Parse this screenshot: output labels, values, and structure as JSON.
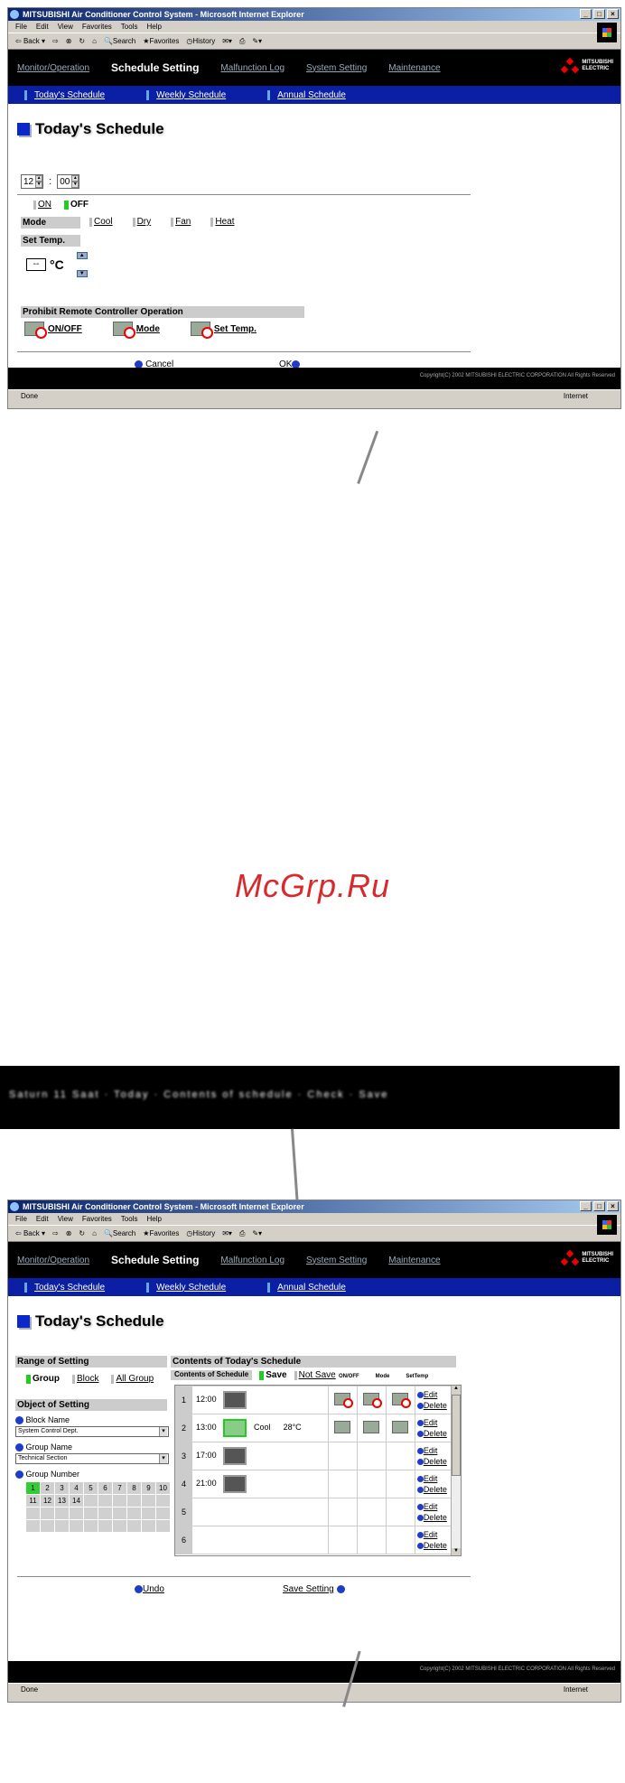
{
  "win1": {
    "title": "MITSUBISHI Air Conditioner Control System - Microsoft Internet Explorer",
    "menu": [
      "File",
      "Edit",
      "View",
      "Favorites",
      "Tools",
      "Help"
    ],
    "toolbar": [
      "Back",
      "Search",
      "Favorites",
      "History"
    ],
    "nav": [
      "Monitor/Operation",
      "Schedule Setting",
      "Malfunction Log",
      "System Setting",
      "Maintenance"
    ],
    "brand": [
      "MITSUBISHI",
      "ELECTRIC"
    ],
    "subnav": [
      "Today's Schedule",
      "Weekly Schedule",
      "Annual Schedule"
    ],
    "page_title": "Today's Schedule",
    "hour": "12",
    "minute": "00",
    "on": "ON",
    "off": "OFF",
    "mode_label": "Mode",
    "modes": [
      "Cool",
      "Dry",
      "Fan",
      "Heat"
    ],
    "settemp_label": "Set Temp.",
    "temp_value": "--",
    "temp_unit": "°C",
    "prohibit_label": "Prohibit Remote Controller Operation",
    "prohibit": [
      "ON/OFF",
      "Mode",
      "Set Temp."
    ],
    "cancel": "Cancel",
    "ok": "OK",
    "copyright": "Copyright(C) 2002 MITSUBISHI ELECTRIC CORPORATION All Rights Reserved",
    "status": "Done",
    "zone": "Internet"
  },
  "watermark": "McGrp.Ru",
  "blurred_caption": "Saturn 11 Saat · Today · Contents of schedule · Check · Save",
  "win2": {
    "range_label": "Range of Setting",
    "ranges": [
      "Group",
      "Block",
      "All Group"
    ],
    "object_label": "Object of Setting",
    "block_name_label": "Block Name",
    "block_name_value": "System Control Dept.",
    "group_name_label": "Group Name",
    "group_name_value": "Technical Section",
    "group_number_label": "Group Number",
    "group_numbers": [
      "1",
      "2",
      "3",
      "4",
      "5",
      "6",
      "7",
      "8",
      "9",
      "10",
      "11",
      "12",
      "13",
      "14"
    ],
    "contents_label": "Contents of Today's Schedule",
    "contents_sub": "Contents of Schedule",
    "save": "Save",
    "not_save": "Not Save",
    "cols": [
      "ON/OFF",
      "Mode",
      "SetTemp"
    ],
    "rows": [
      {
        "n": "1",
        "time": "12:00",
        "mode": "",
        "temp": ""
      },
      {
        "n": "2",
        "time": "13:00",
        "mode": "Cool",
        "temp": "28°C"
      },
      {
        "n": "3",
        "time": "17:00",
        "mode": "",
        "temp": ""
      },
      {
        "n": "4",
        "time": "21:00",
        "mode": "",
        "temp": ""
      },
      {
        "n": "5",
        "time": "",
        "mode": "",
        "temp": ""
      },
      {
        "n": "6",
        "time": "",
        "mode": "",
        "temp": ""
      }
    ],
    "edit": "Edit",
    "delete": "Delete",
    "undo": "Undo",
    "save_setting": "Save Setting"
  }
}
